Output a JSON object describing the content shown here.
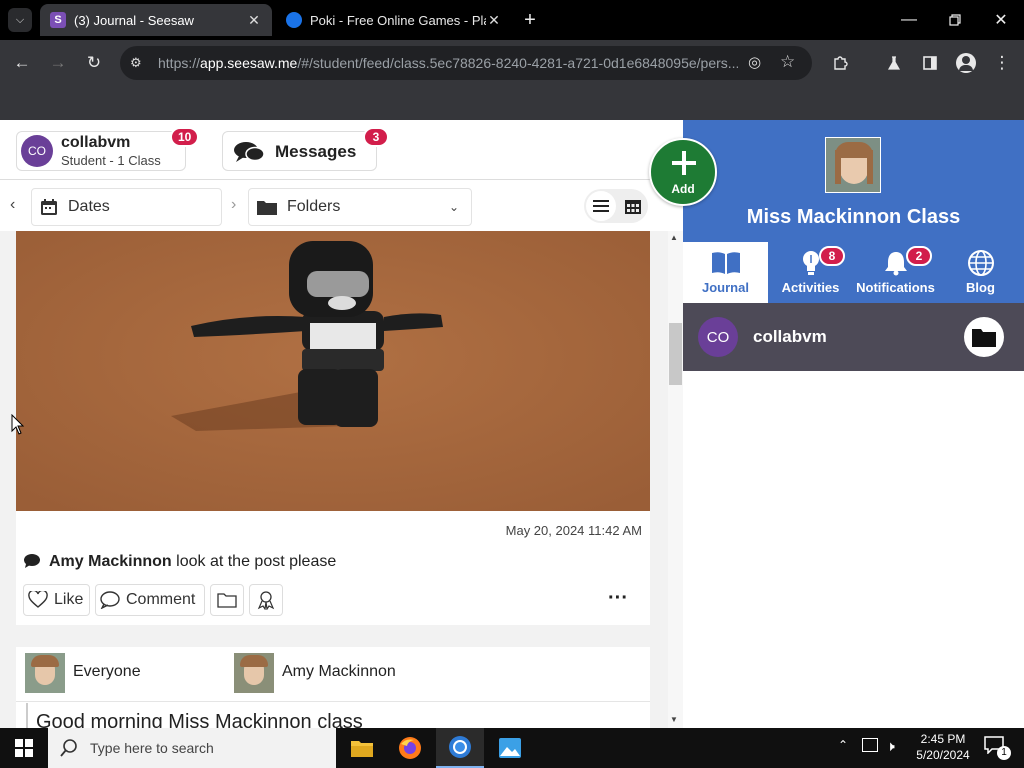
{
  "browser": {
    "tabs": [
      {
        "title": "(3) Journal - Seesaw",
        "favicon": "seesaw-icon",
        "active": true
      },
      {
        "title": "Poki - Free Online Games - Pla",
        "favicon": "poki-icon",
        "active": false
      }
    ],
    "url_prefix": "https://",
    "url_host": "app.seesaw.me",
    "url_path": "/#/student/feed/class.5ec78826-8240-4281-a721-0d1e6848095e/pers..."
  },
  "header": {
    "user_initials": "CO",
    "user_name": "collabvm",
    "user_role": "Student - 1 Class",
    "user_badge": "10",
    "messages_label": "Messages",
    "messages_badge": "3",
    "add_label": "Add"
  },
  "filters": {
    "dates_label": "Dates",
    "folders_label": "Folders"
  },
  "post": {
    "timestamp": "May 20, 2024 11:42 AM",
    "author": "Amy Mackinnon",
    "comment": "look at the post please",
    "like_label": "Like",
    "comment_label": "Comment"
  },
  "post2": {
    "audience": "Everyone",
    "author": "Amy Mackinnon",
    "text": "Good morning Miss Mackinnon class"
  },
  "class_panel": {
    "class_name": "Miss Mackinnon Class",
    "nav": [
      {
        "label": "Journal",
        "icon": "journal-icon",
        "badge": ""
      },
      {
        "label": "Activities",
        "icon": "lightbulb-icon",
        "badge": "8"
      },
      {
        "label": "Notifications",
        "icon": "bell-icon",
        "badge": "2"
      },
      {
        "label": "Blog",
        "icon": "globe-icon",
        "badge": ""
      }
    ],
    "student_initials": "CO",
    "student_name": "collabvm"
  },
  "taskbar": {
    "search_placeholder": "Type here to search",
    "time": "2:45 PM",
    "date": "5/20/2024",
    "notification_count": "1"
  },
  "colors": {
    "seesaw_blue": "#4070c4",
    "badge_red": "#d21e4b",
    "add_green": "#1e7b34",
    "avatar_purple": "#6a3f98"
  }
}
